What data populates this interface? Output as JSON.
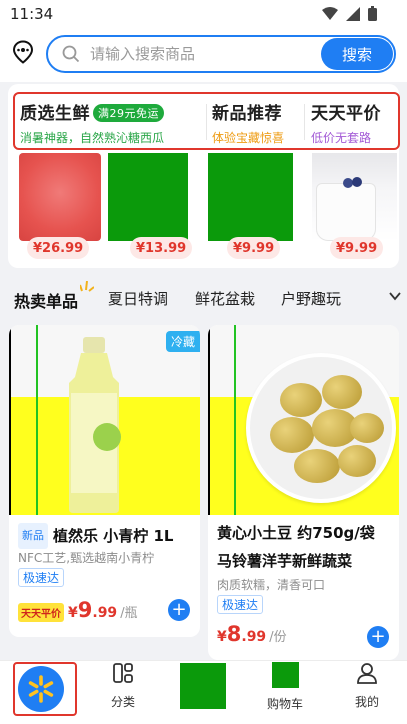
{
  "status_bar": {
    "time": "11:34"
  },
  "search": {
    "placeholder": "请输入搜索商品",
    "button_label": "搜索"
  },
  "promo": {
    "items": [
      {
        "title": "质选生鲜",
        "tag": "满29元免运",
        "subtitle": "消暑神器，自然熟沁糖西瓜"
      },
      {
        "title": "新品推荐",
        "subtitle": "体验宝藏惊喜"
      },
      {
        "title": "天天平价",
        "subtitle": "低价无套路"
      }
    ],
    "prices": [
      "¥26.99",
      "¥13.99",
      "¥9.99",
      "¥9.99"
    ]
  },
  "tabs": [
    "热卖单品",
    "夏日特调",
    "鲜花盆栽",
    "户野趣玩"
  ],
  "products": [
    {
      "badge": "冷藏",
      "new_tag": "新品",
      "title": "植然乐 小青柠 1L",
      "desc": "NFC工艺,甄选越南小青柠",
      "service_tag": "极速达",
      "daily_tag": "天天平价",
      "price_cur": "¥",
      "price_int": "9",
      "price_dec": ".99",
      "unit": "/瓶"
    },
    {
      "title_line1": "黄心小土豆 约750g/袋",
      "title_line2": "马铃薯洋芋新鲜蔬菜",
      "desc": "肉质软糯，清香可口",
      "service_tag": "极速达",
      "price_cur": "¥",
      "price_int": "8",
      "price_dec": ".99",
      "unit": "/份"
    }
  ],
  "bottom_nav": {
    "category_label": "分类",
    "cart_label": "购物车",
    "mine_label": "我的"
  },
  "colors": {
    "brand_blue": "#1f7ef3",
    "price_red": "#e0362c",
    "fresh_green": "#1eaa3c",
    "highlight_frame": "#e0362c"
  }
}
